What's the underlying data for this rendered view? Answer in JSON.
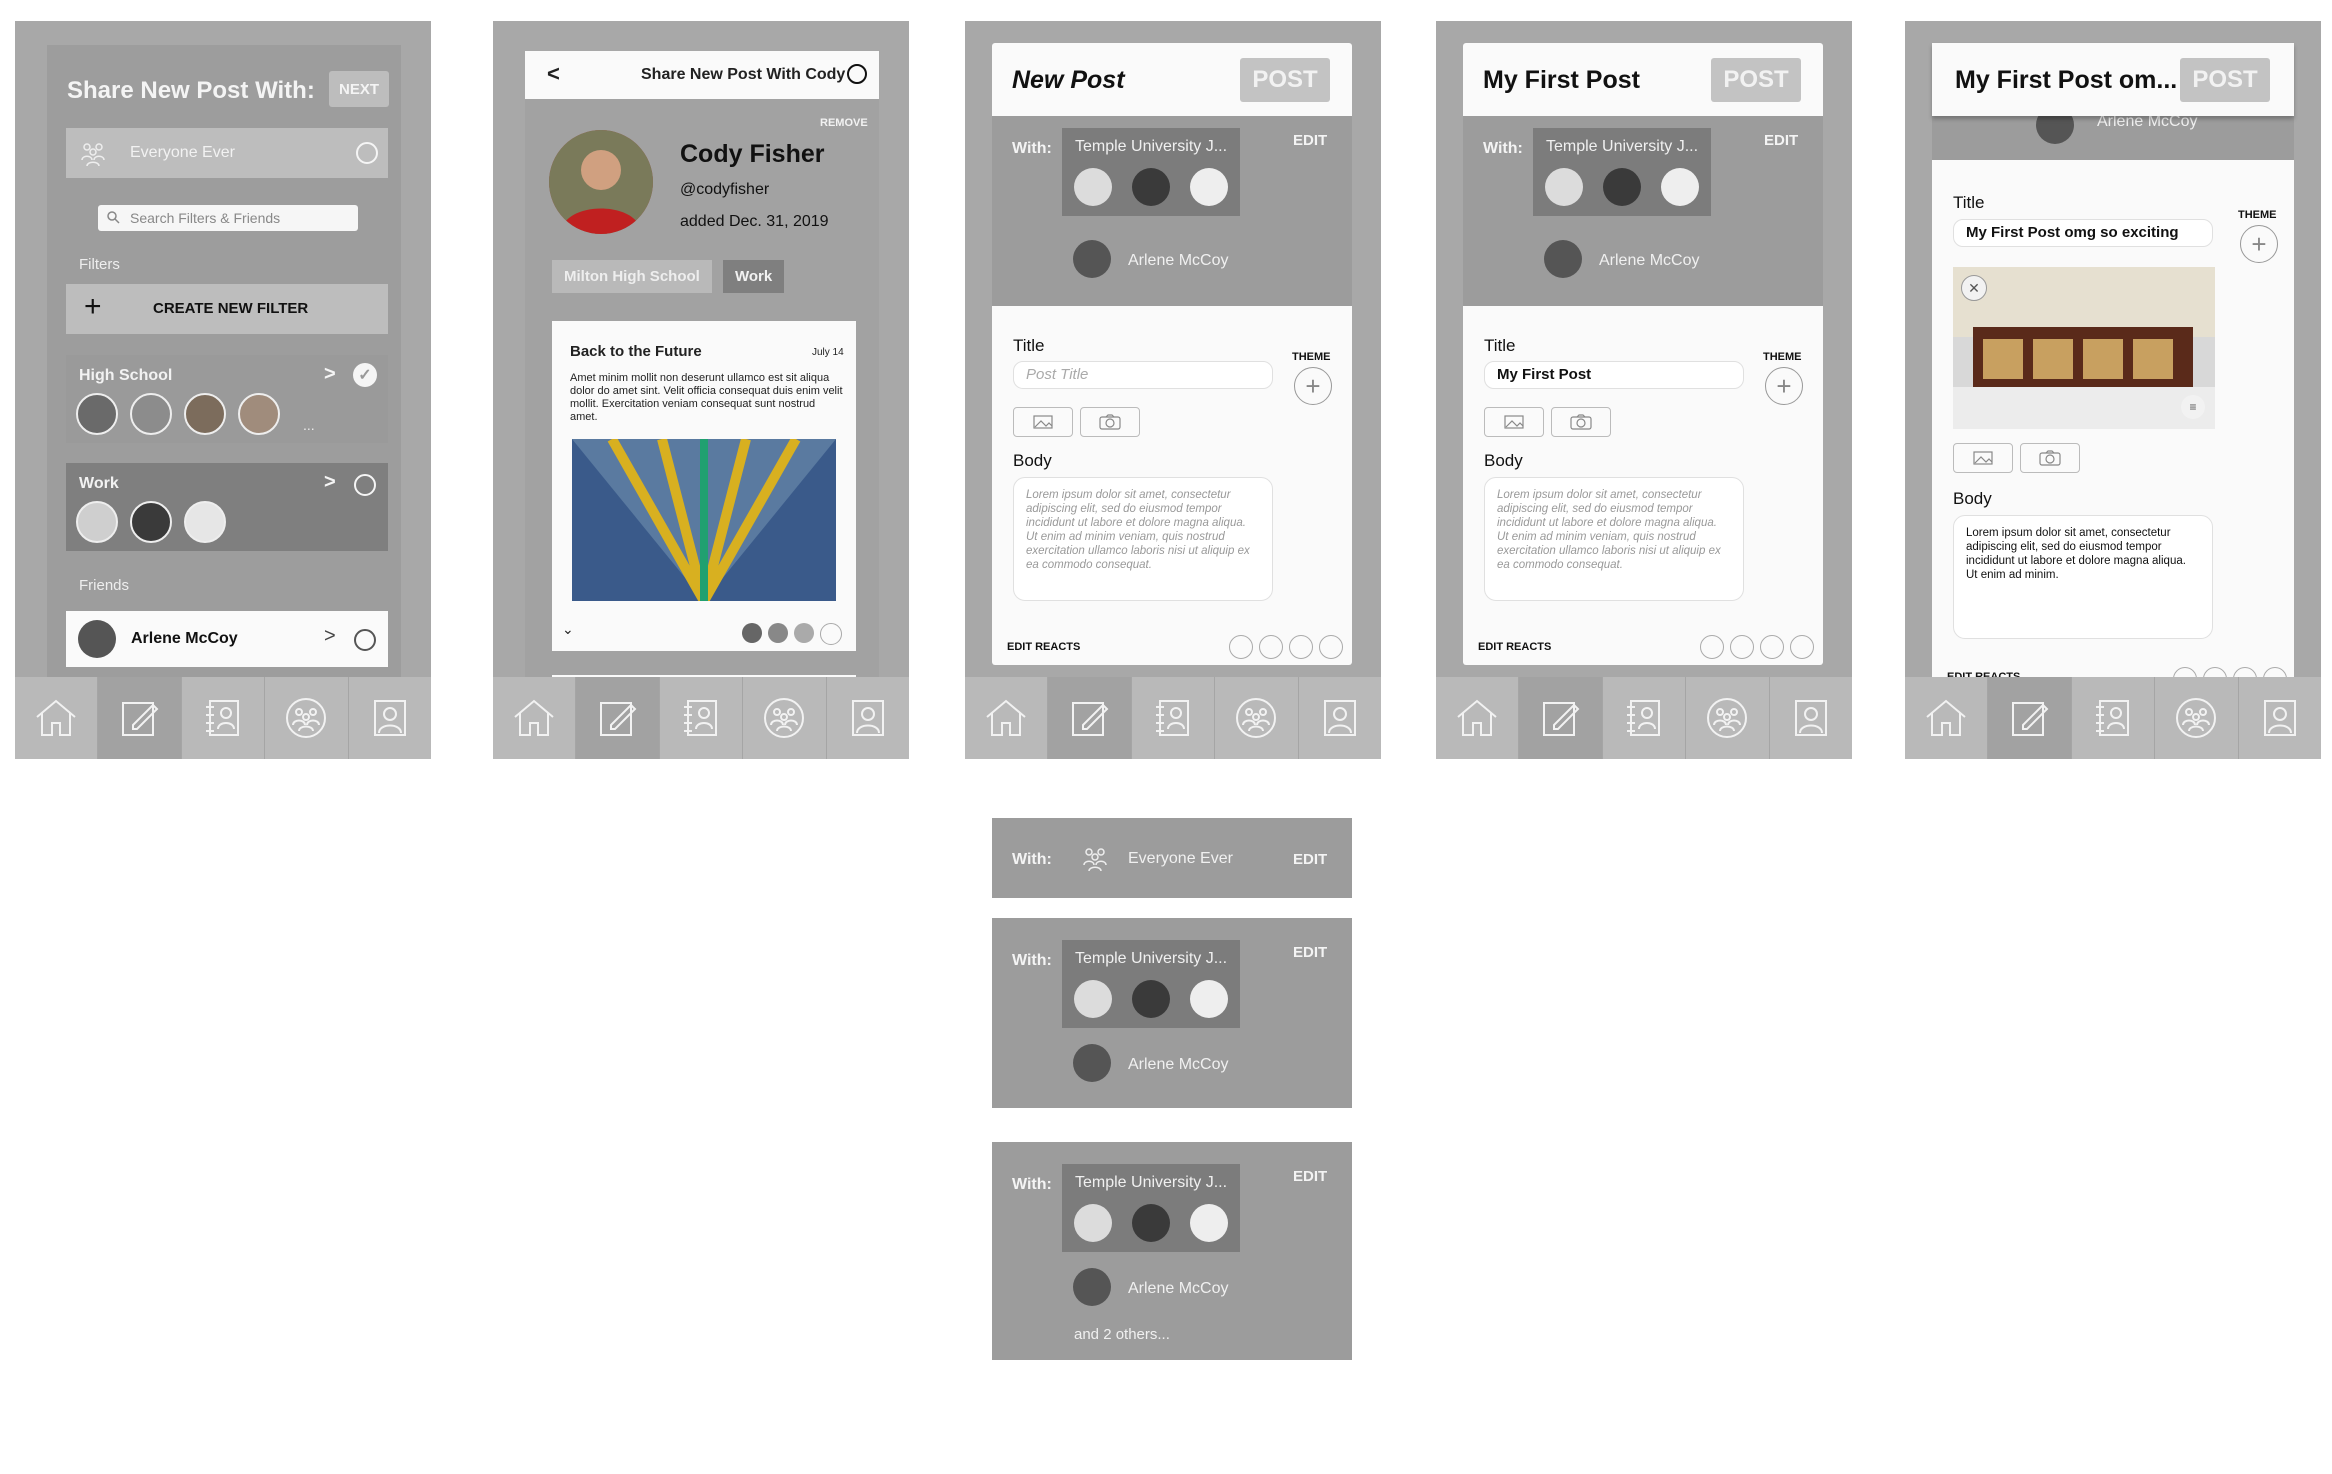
{
  "s1": {
    "title": "Share New Post With:",
    "next": "NEXT",
    "everyone": "Everyone Ever",
    "search_placeholder": "Search Filters & Friends",
    "filters_label": "Filters",
    "create_filter": "CREATE NEW FILTER",
    "high_school": "High School",
    "high_school_more": "...",
    "work": "Work",
    "friends_label": "Friends",
    "friend_name": "Arlene McCoy"
  },
  "s2": {
    "header": "Share New Post With Cody",
    "remove": "REMOVE",
    "name": "Cody Fisher",
    "handle": "@codyfisher",
    "added": "added Dec. 31, 2019",
    "tag_school": "Milton High School",
    "tag_work": "Work",
    "post_title": "Back to the Future",
    "post_date": "July 14",
    "post_body": "Amet minim mollit non deserunt ullamco est sit aliqua dolor do amet sint. Velit officia consequat duis enim velit mollit. Exercitation veniam consequat sunt nostrud amet."
  },
  "s3": {
    "title": "New Post",
    "post": "POST",
    "with": "With:",
    "group": "Temple University J...",
    "edit": "EDIT",
    "person": "Arlene McCoy",
    "title_label": "Title",
    "title_placeholder": "Post Title",
    "theme": "THEME",
    "body_label": "Body",
    "body_placeholder": "Lorem ipsum dolor sit amet, consectetur adipiscing elit, sed do eiusmod tempor incididunt ut labore et dolore magna aliqua. Ut enim ad minim veniam, quis nostrud exercitation ullamco laboris nisi ut aliquip ex ea commodo consequat.",
    "edit_reacts": "EDIT REACTS"
  },
  "s4": {
    "title": "My First Post",
    "post": "POST",
    "with": "With:",
    "group": "Temple University J...",
    "edit": "EDIT",
    "person": "Arlene McCoy",
    "title_label": "Title",
    "title_value": "My First Post",
    "theme": "THEME",
    "body_label": "Body",
    "body_placeholder": "Lorem ipsum dolor sit amet, consectetur adipiscing elit, sed do eiusmod tempor incididunt ut labore et dolore magna aliqua. Ut enim ad minim veniam, quis nostrud exercitation ullamco laboris nisi ut aliquip ex ea commodo consequat.",
    "edit_reacts": "EDIT REACTS"
  },
  "s5": {
    "title": "My First Post om...",
    "post": "POST",
    "person_peek": "Arlene McCoy",
    "title_label": "Title",
    "title_value": "My First Post omg so exciting",
    "theme": "THEME",
    "body_label": "Body",
    "body_value": "Lorem ipsum dolor sit amet, consectetur adipiscing elit, sed do eiusmod tempor incididunt ut labore et dolore magna aliqua. Ut enim ad minim.",
    "edit_reacts": "EDIT REACTS"
  },
  "v1": {
    "with": "With:",
    "everyone": "Everyone Ever",
    "edit": "EDIT"
  },
  "v2": {
    "with": "With:",
    "group": "Temple University J...",
    "edit": "EDIT",
    "person": "Arlene McCoy"
  },
  "v3": {
    "with": "With:",
    "group": "Temple University J...",
    "edit": "EDIT",
    "person": "Arlene McCoy",
    "others": "and 2 others..."
  },
  "nav_icons": [
    "home-icon",
    "compose-icon",
    "contacts-icon",
    "groups-icon",
    "profile-icon"
  ],
  "colors": {
    "screen_bg": "#a8a8a8",
    "nav_bg": "#b9b9b9",
    "group_box": "#7c7c7c",
    "card_bg": "#fafafa"
  }
}
